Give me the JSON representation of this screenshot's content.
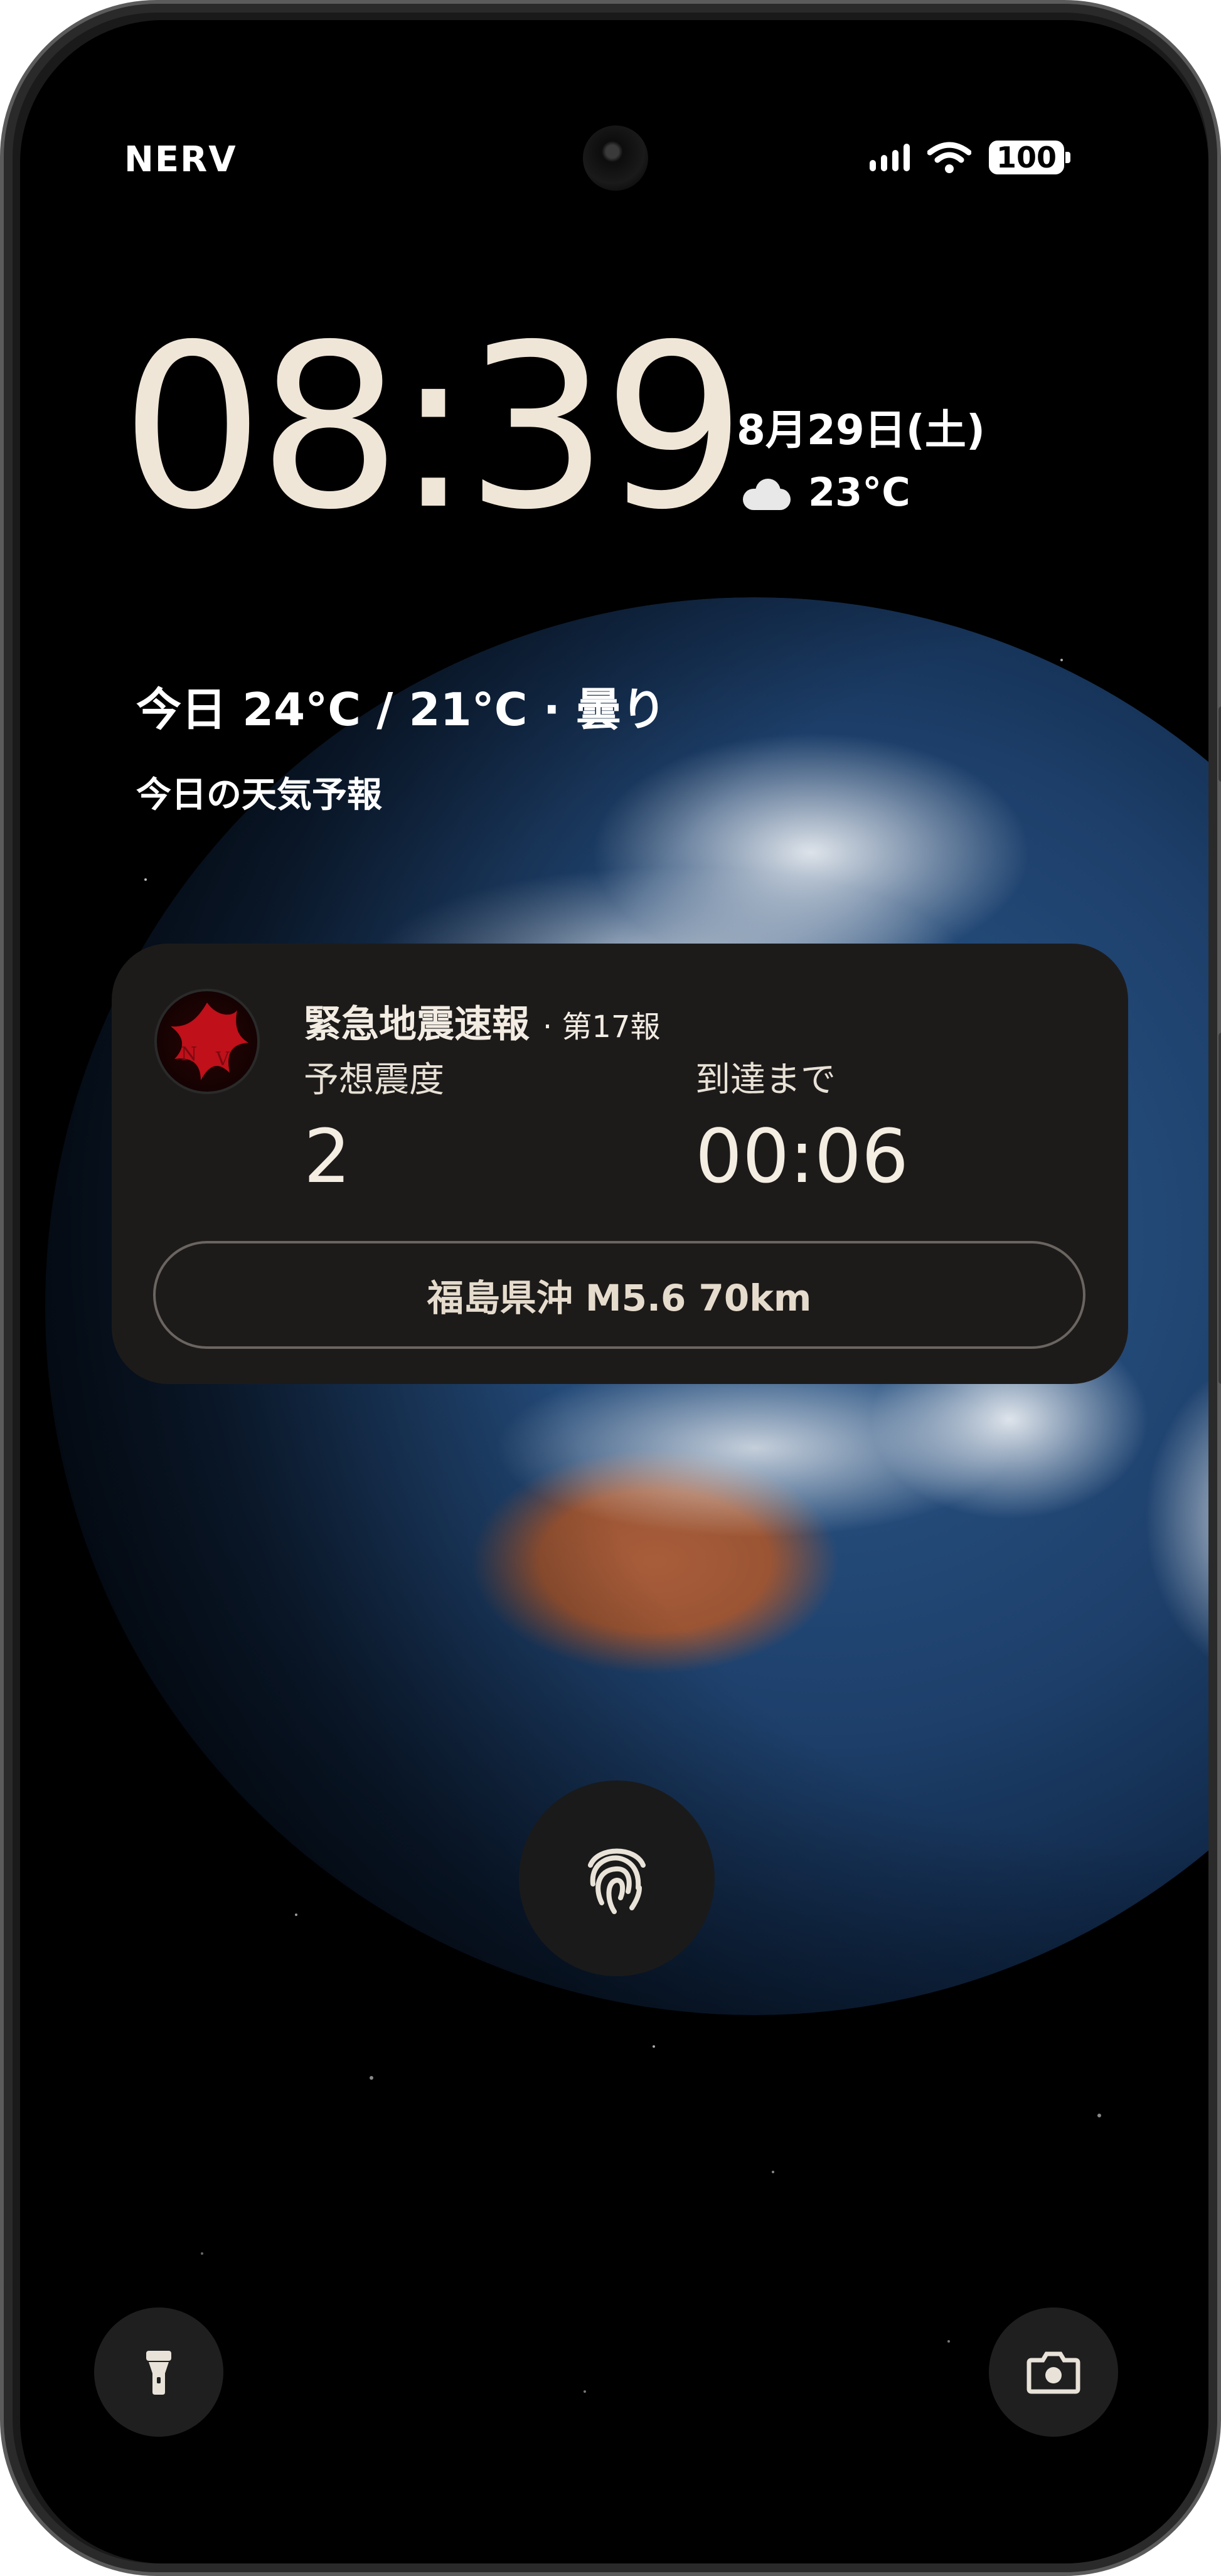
{
  "status_bar": {
    "carrier": "NERV",
    "battery": "100"
  },
  "lock_screen": {
    "time": "08:39",
    "date": "8月29日(土)",
    "current_temp": "23°C",
    "weather_icon": "cloud-icon",
    "forecast_line": "今日 24°C / 21°C · 曇り",
    "forecast_sub": "今日の天気予報"
  },
  "alert": {
    "title": "緊急地震速報",
    "report_number": "· 第17報",
    "intensity_label": "予想震度",
    "intensity_value": "2",
    "arrival_label": "到達まで",
    "arrival_value": "00:06",
    "location_info": "福島県沖  M5.6  70km",
    "logo_icon": "nerv-logo"
  },
  "buttons": {
    "unlock_icon": "fingerprint-icon",
    "left_quick_icon": "flashlight-icon",
    "right_quick_icon": "camera-icon"
  },
  "colors": {
    "clock": "#efe6d8",
    "card_bg": "#1d1b1a",
    "accent_red": "#c0101a"
  }
}
